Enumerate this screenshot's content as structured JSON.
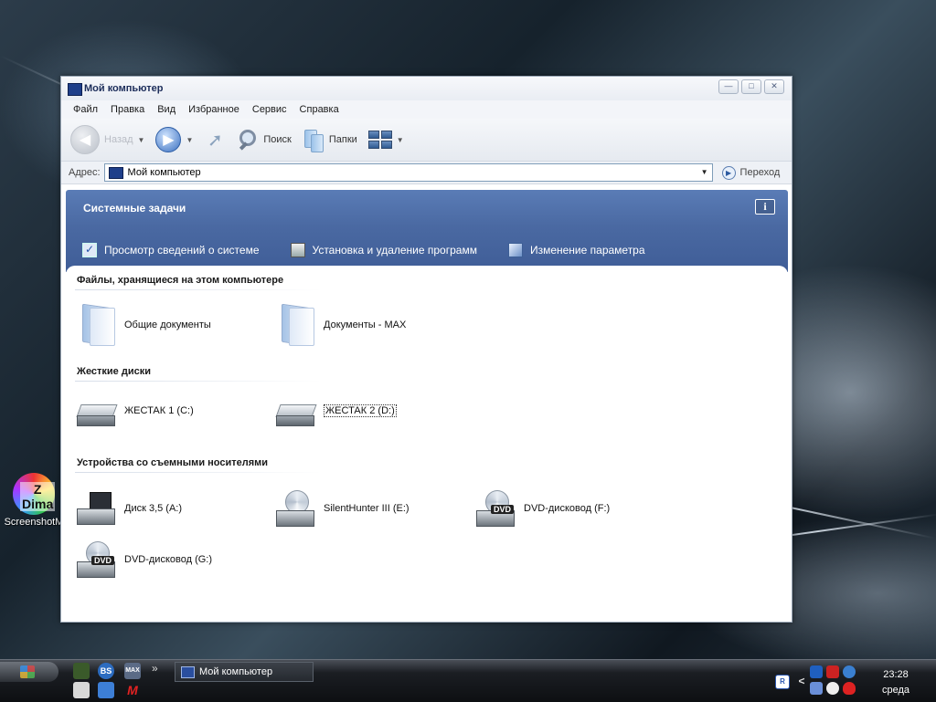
{
  "desktop": {
    "icon_label": "ScreenshotM",
    "icon_glyph": "Z Dima"
  },
  "window": {
    "title": "Мой компьютер",
    "controls": {
      "minimize": "—",
      "maximize": "□",
      "close": "✕"
    }
  },
  "menu": [
    "Файл",
    "Правка",
    "Вид",
    "Избранное",
    "Сервис",
    "Справка"
  ],
  "toolbar": {
    "back_label": "Назад",
    "search_label": "Поиск",
    "folders_label": "Папки"
  },
  "address": {
    "label": "Адрес:",
    "value": "Мой компьютер",
    "go_label": "Переход"
  },
  "tasks": {
    "title": "Системные задачи",
    "info_glyph": "i",
    "links": [
      {
        "label": "Просмотр сведений о системе",
        "icon": "check-icon"
      },
      {
        "label": "Установка и удаление программ",
        "icon": "install-icon"
      },
      {
        "label": "Изменение параметра",
        "icon": "settings-icon"
      }
    ]
  },
  "groups": [
    {
      "title": "Файлы, хранящиеся на этом компьютере",
      "items": [
        {
          "label": "Общие документы",
          "icon": "folder-icon"
        },
        {
          "label": "Документы - MAX",
          "icon": "folder-icon"
        }
      ]
    },
    {
      "title": "Жесткие диски",
      "items": [
        {
          "label": "ЖЕСТАК 1 (C:)",
          "icon": "hard-drive-icon"
        },
        {
          "label": "ЖЕСТАК 2 (D:)",
          "icon": "hard-drive-icon",
          "selected": true
        }
      ]
    },
    {
      "title": "Устройства со съемными носителями",
      "items": [
        {
          "label": "Диск 3,5 (A:)",
          "icon": "floppy-drive-icon"
        },
        {
          "label": "SilentHunter III (E:)",
          "icon": "cd-drive-icon"
        },
        {
          "label": "DVD-дисковод (F:)",
          "icon": "dvd-drive-icon",
          "badge": "DVD"
        },
        {
          "label": "DVD-дисковод (G:)",
          "icon": "dvd-drive-icon",
          "badge": "DVD"
        }
      ]
    }
  ],
  "taskbar": {
    "quick_launch": [
      "BS",
      "MAX",
      "M"
    ],
    "chevron": "»",
    "active_task": "Мой компьютер",
    "tray_chevron": "<",
    "tray_lang": "R",
    "clock_time": "23:28",
    "clock_day": "среда"
  }
}
